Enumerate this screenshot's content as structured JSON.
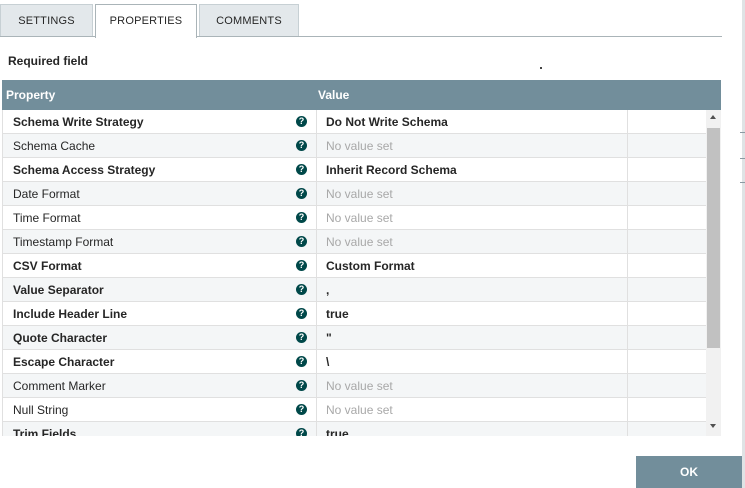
{
  "tabs": [
    {
      "label": "SETTINGS"
    },
    {
      "label": "PROPERTIES"
    },
    {
      "label": "COMMENTS"
    }
  ],
  "required_label": "Required field",
  "table": {
    "columns": {
      "property": "Property",
      "value": "Value"
    },
    "rows": [
      {
        "name": "Schema Write Strategy",
        "value": "Do Not Write Schema",
        "required": true,
        "empty": false
      },
      {
        "name": "Schema Cache",
        "value": "No value set",
        "required": false,
        "empty": true
      },
      {
        "name": "Schema Access Strategy",
        "value": "Inherit Record Schema",
        "required": true,
        "empty": false
      },
      {
        "name": "Date Format",
        "value": "No value set",
        "required": false,
        "empty": true
      },
      {
        "name": "Time Format",
        "value": "No value set",
        "required": false,
        "empty": true
      },
      {
        "name": "Timestamp Format",
        "value": "No value set",
        "required": false,
        "empty": true
      },
      {
        "name": "CSV Format",
        "value": "Custom Format",
        "required": true,
        "empty": false
      },
      {
        "name": "Value Separator",
        "value": ",",
        "required": true,
        "empty": false
      },
      {
        "name": "Include Header Line",
        "value": "true",
        "required": true,
        "empty": false
      },
      {
        "name": "Quote Character",
        "value": "\"",
        "required": true,
        "empty": false
      },
      {
        "name": "Escape Character",
        "value": "\\",
        "required": true,
        "empty": false
      },
      {
        "name": "Comment Marker",
        "value": "No value set",
        "required": false,
        "empty": true
      },
      {
        "name": "Null String",
        "value": "No value set",
        "required": false,
        "empty": true
      },
      {
        "name": "Trim Fields",
        "value": "true",
        "required": true,
        "empty": false
      }
    ],
    "help_icon": "question-circle-icon"
  },
  "buttons": {
    "ok": "OK"
  },
  "colors": {
    "header": "#728e9b",
    "help_icon": "#004849",
    "tab_inactive": "#e3e8eb",
    "placeholder_text": "#a8a8a8"
  }
}
